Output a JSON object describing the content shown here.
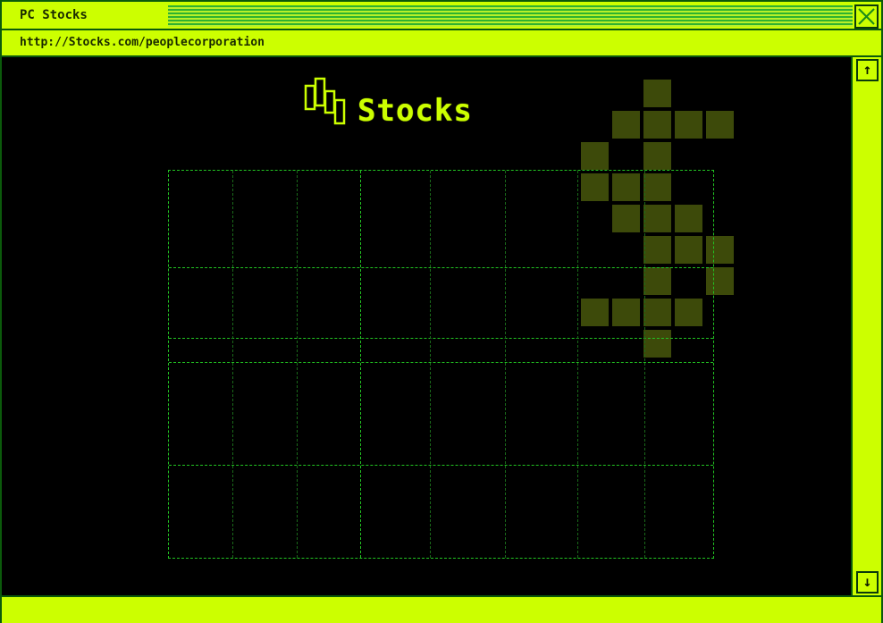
{
  "window": {
    "title": "PC Stocks",
    "url": "http://Stocks.com/peoplecorporation"
  },
  "page": {
    "logo_text": "Stocks"
  },
  "colors": {
    "chrome": "#ccff00",
    "border": "#0b5a0b",
    "grid": "#22c322",
    "background": "#000000",
    "dollar_pixels": "#3d4a0a"
  },
  "icons": {
    "close": "close-icon",
    "scroll_up": "arrow-up-icon",
    "scroll_down": "arrow-down-icon",
    "logo": "stocks-bars-icon",
    "decoration": "dollar-sign-icon"
  },
  "scroll": {
    "up_glyph": "↑",
    "down_glyph": "↓"
  }
}
